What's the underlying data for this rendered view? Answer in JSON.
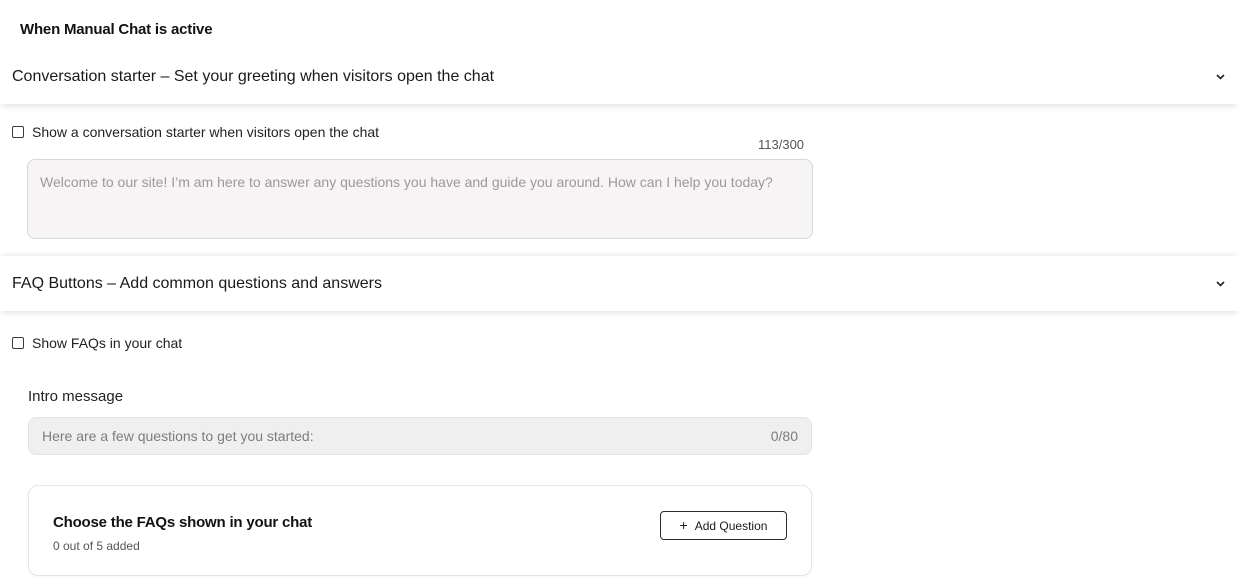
{
  "section": {
    "title": "When Manual Chat is active"
  },
  "conversation_starter": {
    "header": "Conversation starter – Set your greeting when visitors open the chat",
    "toggle_label": "Show a conversation starter when visitors open the chat",
    "checked": false,
    "counter": "113/300",
    "message": "Welcome to our site! I’m am here to answer any questions you have and guide you around. How can I help you today?"
  },
  "faq": {
    "header": "FAQ Buttons – Add common questions and answers",
    "toggle_label": "Show FAQs in your chat",
    "checked": false,
    "intro_label": "Intro message",
    "intro_placeholder": "Here are a few questions to get you started:",
    "intro_counter": "0/80",
    "card": {
      "title": "Choose the FAQs shown in your chat",
      "subtitle": "0 out of 5 added",
      "add_button_label": "Add Question"
    }
  },
  "icons": {
    "expand": "chevron-down-icon",
    "add": "plus-icon"
  }
}
